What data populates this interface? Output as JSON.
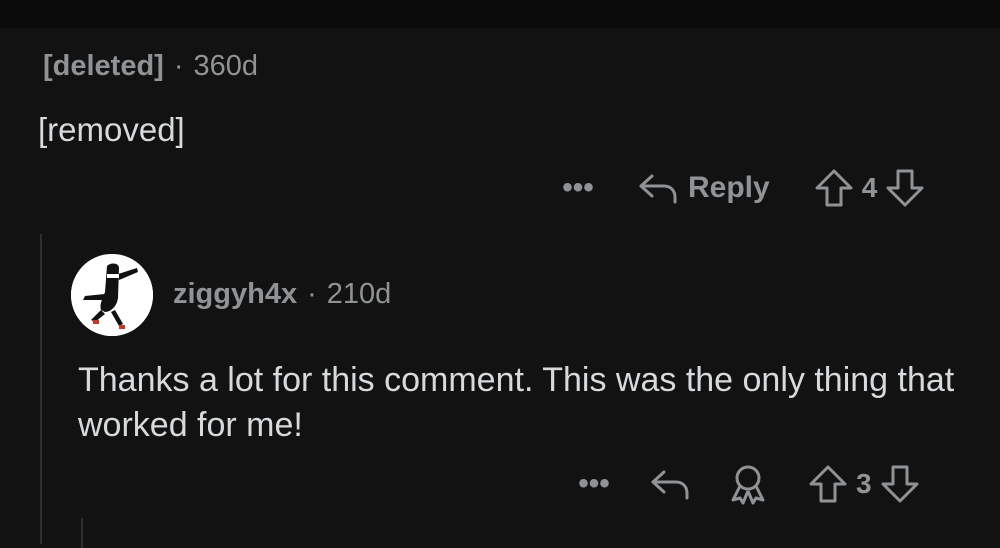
{
  "comments": [
    {
      "author": "[deleted]",
      "separator": "·",
      "age": "360d",
      "body": "[removed]",
      "more_label": "•••",
      "reply_label": "Reply",
      "score": "4"
    },
    {
      "author": "ziggyh4x",
      "separator": "·",
      "age": "210d",
      "body": "Thanks a lot for this comment. This was the only thing that worked for me!",
      "more_label": "•••",
      "score": "3"
    }
  ],
  "icons": {
    "reply": "reply-arrow-icon",
    "award": "award-icon",
    "upvote": "upvote-arrow-icon",
    "downvote": "downvote-arrow-icon"
  },
  "colors": {
    "background": "#121212",
    "text": "#d7dadc",
    "muted": "#8f9396"
  }
}
